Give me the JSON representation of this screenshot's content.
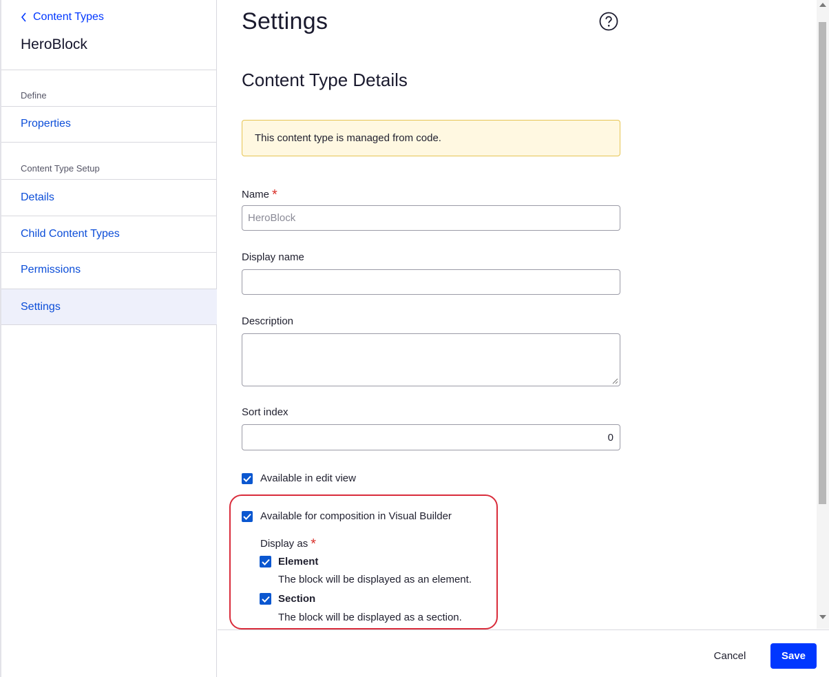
{
  "sidebar": {
    "back_label": "Content Types",
    "title": "HeroBlock",
    "groups": [
      {
        "label": "Define",
        "items": [
          {
            "label": "Properties"
          }
        ]
      },
      {
        "label": "Content Type Setup",
        "items": [
          {
            "label": "Details"
          },
          {
            "label": "Child Content Types"
          },
          {
            "label": "Permissions"
          },
          {
            "label": "Settings",
            "active": true
          }
        ]
      }
    ]
  },
  "main": {
    "title": "Settings",
    "section_title": "Content Type Details",
    "notice": "This content type is managed from code.",
    "fields": {
      "name": {
        "label": "Name",
        "value": "HeroBlock",
        "required": "*"
      },
      "display_name": {
        "label": "Display name",
        "value": ""
      },
      "description": {
        "label": "Description",
        "value": ""
      },
      "sort_index": {
        "label": "Sort index",
        "value": "0"
      }
    },
    "checkboxes": {
      "edit_view": {
        "label": "Available in edit view",
        "checked": true
      },
      "visual_builder": {
        "label": "Available for composition in Visual Builder",
        "checked": true
      }
    },
    "display_as": {
      "label": "Display as",
      "required": "*",
      "options": [
        {
          "label": "Element",
          "description": "The block will be displayed as an element.",
          "checked": true
        },
        {
          "label": "Section",
          "description": "The block will be displayed as a section.",
          "checked": true
        }
      ]
    }
  },
  "footer": {
    "cancel_label": "Cancel",
    "save_label": "Save"
  },
  "colors": {
    "accent": "#0037ff",
    "link": "#0b4dd8",
    "highlight": "#d92b3a",
    "required": "#d9322c"
  }
}
